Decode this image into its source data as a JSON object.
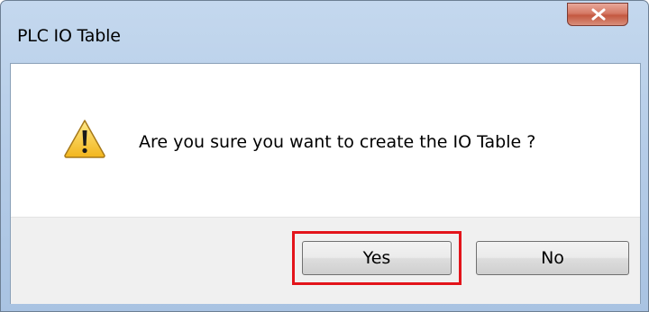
{
  "window": {
    "title": "PLC IO Table"
  },
  "message": {
    "icon": "warning-icon",
    "text": "Are you sure you want to create the IO Table ?"
  },
  "buttons": {
    "yes_label": "Yes",
    "no_label": "No"
  },
  "colors": {
    "highlight": "#e3141b",
    "close_button": "#c45840",
    "title_bar": "#b6cde8"
  }
}
